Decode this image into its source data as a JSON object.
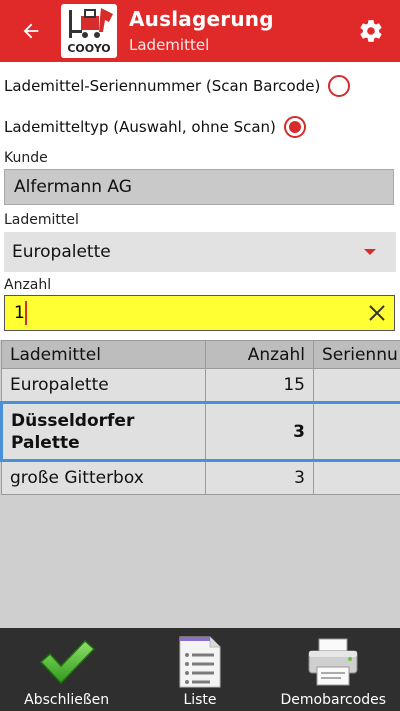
{
  "appbar": {
    "title": "Auslagerung",
    "subtitle": "Lademittel",
    "logo_text": "COOYO",
    "accent_color": "#e02a2a"
  },
  "options": {
    "serial_label": "Lademittel-Seriennummer (Scan Barcode)",
    "serial_checked": false,
    "type_label": "Lademitteltyp (Auswahl, ohne Scan)",
    "type_checked": true
  },
  "kunde": {
    "label": "Kunde",
    "value": "Alfermann AG"
  },
  "lademittel": {
    "label": "Lademittel",
    "selected": "Europalette"
  },
  "anzahl": {
    "label": "Anzahl",
    "value": "1"
  },
  "table": {
    "columns": [
      "Lademittel",
      "Anzahl",
      "Seriennu"
    ],
    "rows": [
      {
        "name": "Europalette",
        "count": "15",
        "serial": ""
      },
      {
        "name": "Düsseldorfer Palette",
        "count": "3",
        "serial": ""
      },
      {
        "name": "große Gitterbox",
        "count": "3",
        "serial": ""
      }
    ]
  },
  "bottom": {
    "finish_label": "Abschließen",
    "list_label": "Liste",
    "demo_label": "Demobarcodes"
  }
}
